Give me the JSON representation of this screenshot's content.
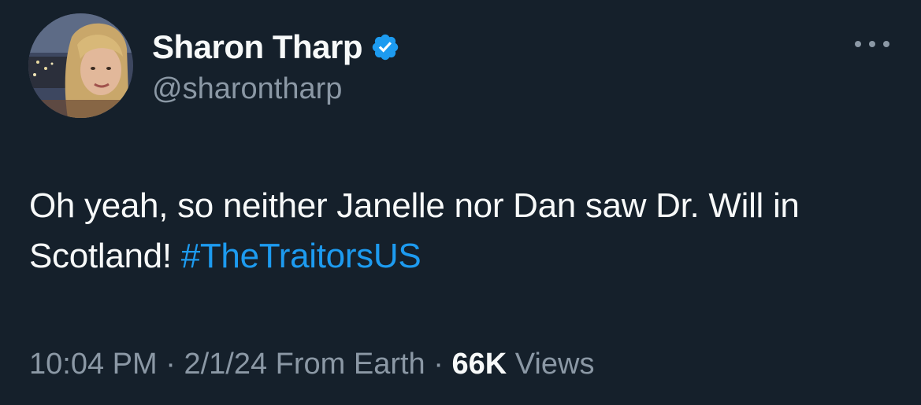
{
  "author": {
    "display_name": "Sharon Tharp",
    "handle": "@sharontharp",
    "verified": true,
    "verified_color": "#1d9bf0"
  },
  "tweet": {
    "text_before": "Oh yeah, so neither Janelle nor Dan saw Dr. Will in Scotland! ",
    "hashtag": "#TheTraitorsUS"
  },
  "meta": {
    "time": "10:04 PM",
    "separator": " · ",
    "date": "2/1/24",
    "source": "From Earth",
    "views_count": "66K",
    "views_label": "Views"
  },
  "icons": {
    "more": "more-horizontal-icon",
    "verified": "verified-badge-icon"
  },
  "colors": {
    "background": "#15202b",
    "text": "#f7f9f9",
    "secondary": "#8b98a5",
    "link": "#1d9bf0"
  }
}
